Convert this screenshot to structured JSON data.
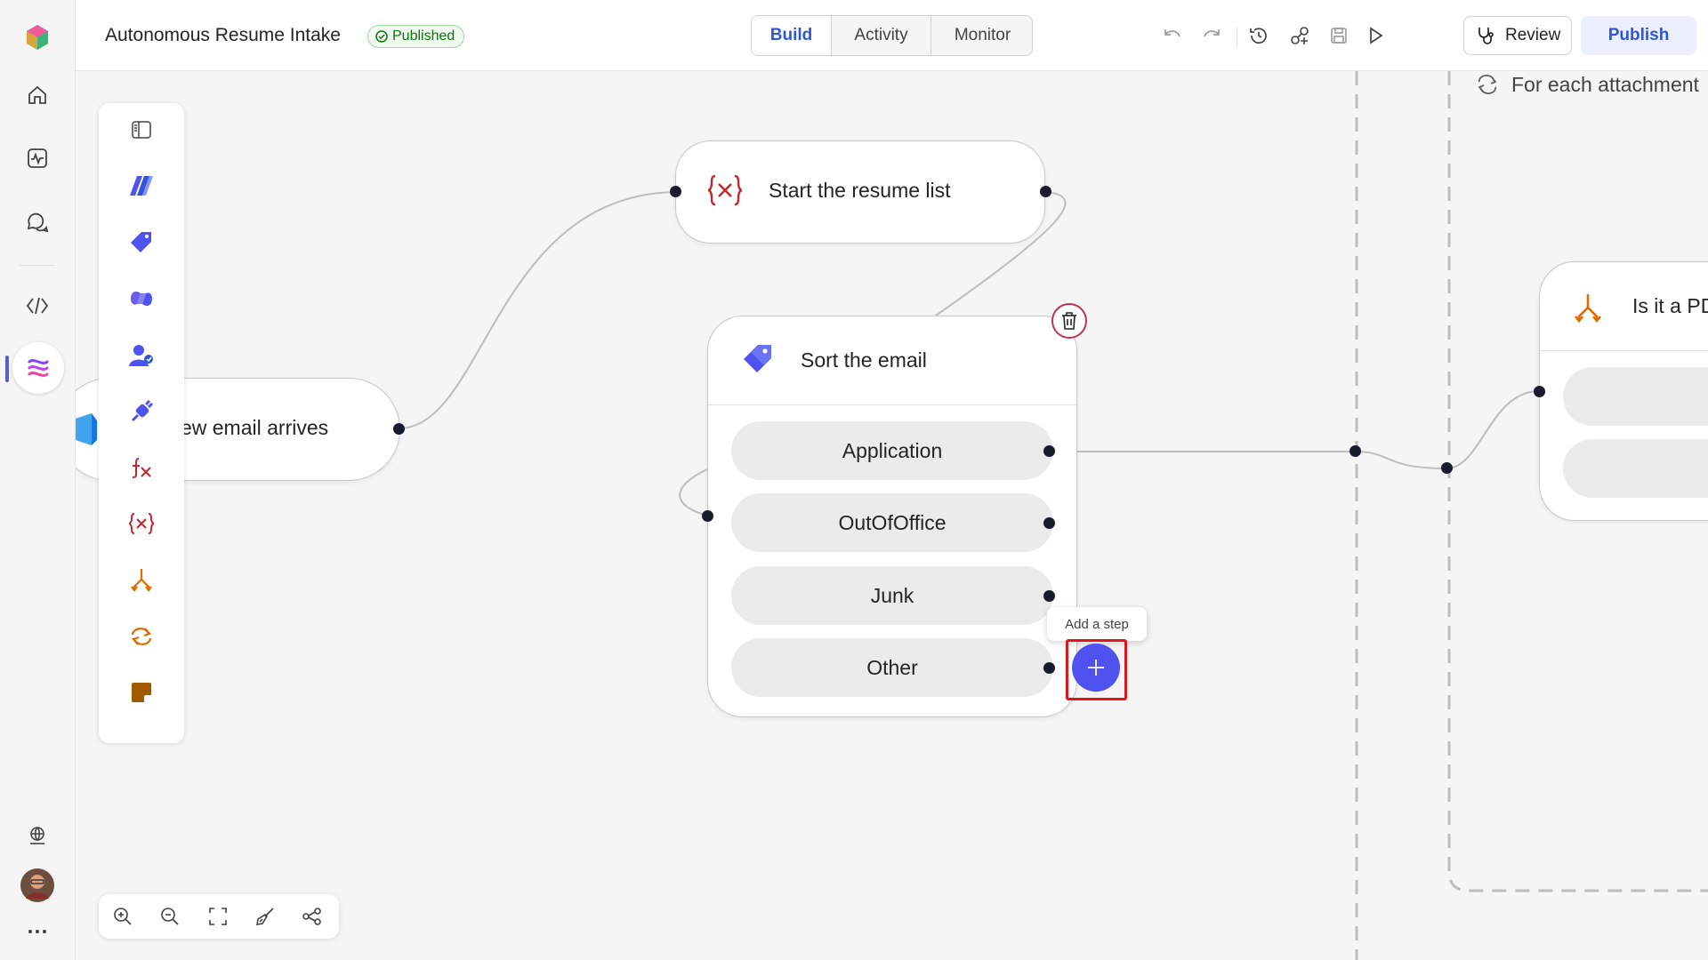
{
  "app": {
    "title": "Autonomous Resume Intake",
    "status": "Published"
  },
  "tabs": [
    {
      "label": "Build",
      "active": true
    },
    {
      "label": "Activity",
      "active": false
    },
    {
      "label": "Monitor",
      "active": false
    }
  ],
  "toolbar": {
    "review_label": "Review",
    "publish_label": "Publish"
  },
  "nodes": {
    "trigger": {
      "title": "a new email arrives"
    },
    "start_list": {
      "title": "Start the resume list"
    },
    "sort": {
      "title": "Sort the email",
      "branches": [
        "Application",
        "OutOfOffice",
        "Junk",
        "Other"
      ]
    },
    "loop": {
      "title": "For each attachment"
    },
    "condition": {
      "title": "Is it a PD"
    }
  },
  "tooltip": {
    "label": "Add a step"
  },
  "colors": {
    "accent": "#2f56d6",
    "add_button": "#4f52ef",
    "highlight": "#e0161d",
    "variable_red": "#c4262e",
    "condition_orange": "#e06c00",
    "published_green": "#0e700e"
  },
  "icons": {
    "rail": [
      "app-logo-icon",
      "home-icon",
      "activity-icon",
      "chat-icon",
      "code-icon",
      "flow-icon",
      "globe-icon",
      "avatar",
      "more-icon"
    ],
    "palette": [
      "panel-toggle-icon",
      "ai-icon",
      "tag-icon",
      "copilot-icon",
      "human-icon",
      "connector-icon",
      "fx-icon",
      "variable-icon",
      "condition-icon",
      "loop-icon",
      "note-icon"
    ],
    "zoom": [
      "zoom-in-icon",
      "zoom-out-icon",
      "fit-view-icon",
      "tidy-icon",
      "map-icon"
    ]
  }
}
